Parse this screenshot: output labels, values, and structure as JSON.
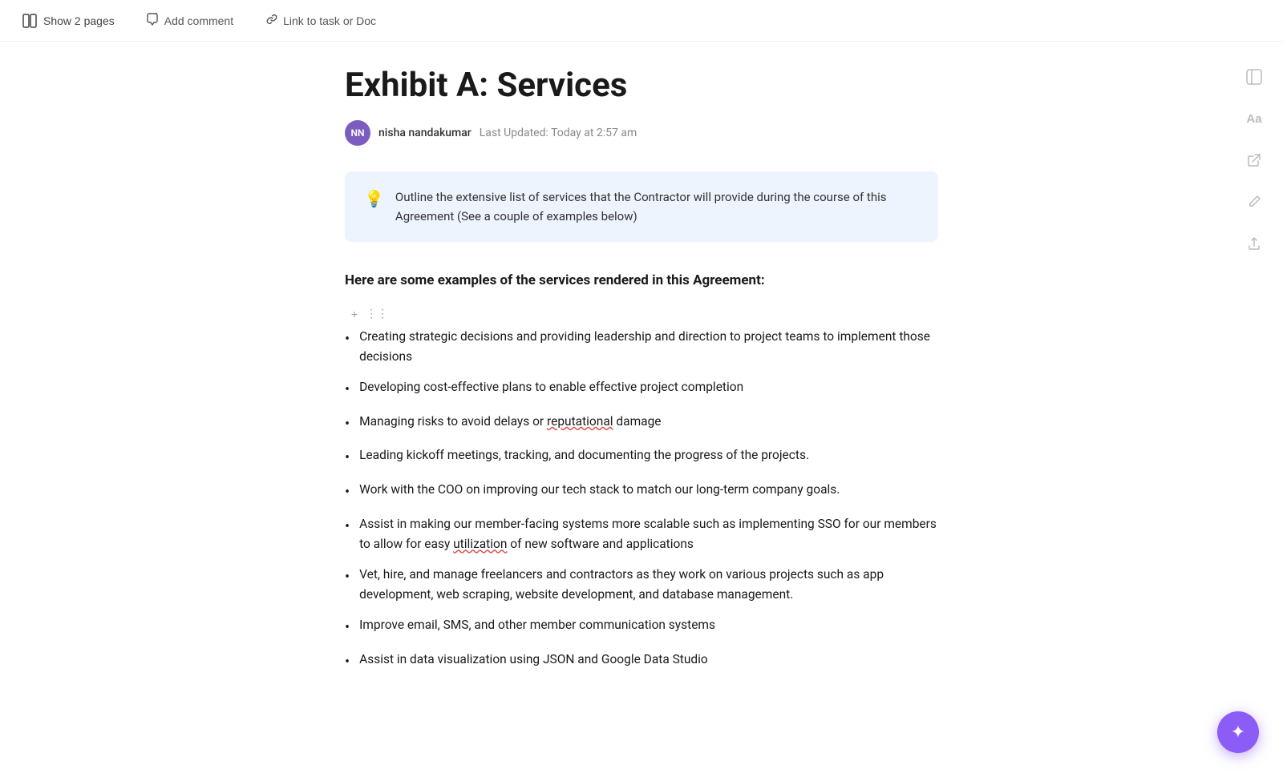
{
  "toolbar": {
    "show_pages_label": "Show 2 pages",
    "add_comment_label": "Add comment",
    "link_to_task_label": "Link to task or Doc"
  },
  "page": {
    "title": "Exhibit A: Services",
    "author": {
      "initials": "NN",
      "name": "nisha nandakumar",
      "last_updated": "Last Updated:  Today at 2:57 am"
    },
    "callout": {
      "emoji": "💡",
      "text": "Outline the extensive list of services that the Contractor will provide during the course of this Agreement (See a couple of examples below)"
    },
    "section_heading": "Here are some examples of the services rendered in this Agreement:",
    "bullet_items": [
      {
        "text": "Creating strategic decisions and providing leadership and direction to project teams to implement those decisions",
        "has_underline": false
      },
      {
        "text": "Developing cost-effective plans to enable effective project completion",
        "has_underline": false
      },
      {
        "text": "Managing risks to avoid delays or reputational damage",
        "has_underline": true,
        "underline_word": "reputational"
      },
      {
        "text": "Leading kickoff meetings, tracking, and documenting the progress of the projects.",
        "has_underline": false
      },
      {
        "text": "Work with the COO on improving our tech stack to match our long-term company goals.",
        "has_underline": false
      },
      {
        "text": "Assist in making our member-facing systems more scalable such as implementing SSO for our members to allow for easy utilization of new software and applications",
        "has_underline": true,
        "underline_word": "utilization"
      },
      {
        "text": "Vet, hire, and manage freelancers and contractors as they work on various projects such as app development, web scraping, website development, and database management.",
        "has_underline": false
      },
      {
        "text": "Improve email, SMS, and other member communication systems",
        "has_underline": false
      },
      {
        "text": "Assist in data visualization using JSON and Google Data Studio",
        "has_underline": false
      }
    ]
  },
  "right_sidebar": {
    "icons": [
      {
        "name": "sidebar-toggle-icon",
        "symbol": "⊞"
      },
      {
        "name": "font-size-icon",
        "symbol": "Aa"
      },
      {
        "name": "share-icon",
        "symbol": "↗"
      },
      {
        "name": "edit-icon",
        "symbol": "✏"
      },
      {
        "name": "export-icon",
        "symbol": "↑"
      }
    ]
  },
  "fab": {
    "symbol": "✦"
  }
}
